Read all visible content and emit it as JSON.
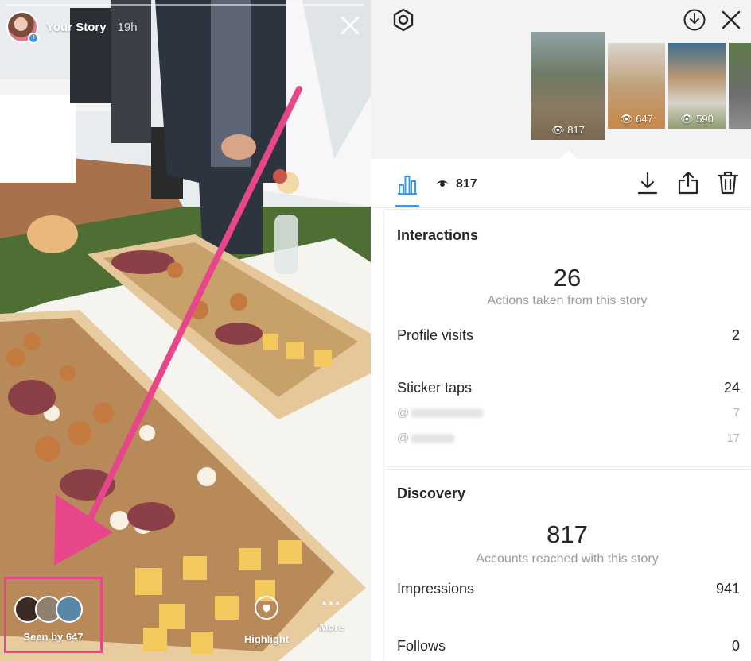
{
  "story": {
    "title": "Your Story",
    "time": "19h",
    "seen_by": "Seen by 647",
    "highlight_label": "Highlight",
    "more_label": "More",
    "accent_color": "#e8468a"
  },
  "insights": {
    "thumbnails": [
      {
        "views": "817"
      },
      {
        "views": "647"
      },
      {
        "views": "590"
      }
    ],
    "views": "817",
    "interactions": {
      "title": "Interactions",
      "total": "26",
      "total_label": "Actions taken from this story",
      "profile_visits_label": "Profile visits",
      "profile_visits": "2",
      "sticker_taps_label": "Sticker taps",
      "sticker_taps": "24",
      "sticker_items": [
        {
          "label": "@",
          "value": "7"
        },
        {
          "label": "@",
          "value": "17"
        }
      ]
    },
    "discovery": {
      "title": "Discovery",
      "reach": "817",
      "reach_label": "Accounts reached with this story",
      "impressions_label": "Impressions",
      "impressions": "941",
      "follows_label": "Follows",
      "follows": "0"
    }
  },
  "icons": [
    "gear-icon",
    "download-circle-icon",
    "close-icon",
    "chart-icon",
    "eye-icon",
    "download-icon",
    "share-icon",
    "trash-icon",
    "heart-icon",
    "more-icon"
  ]
}
